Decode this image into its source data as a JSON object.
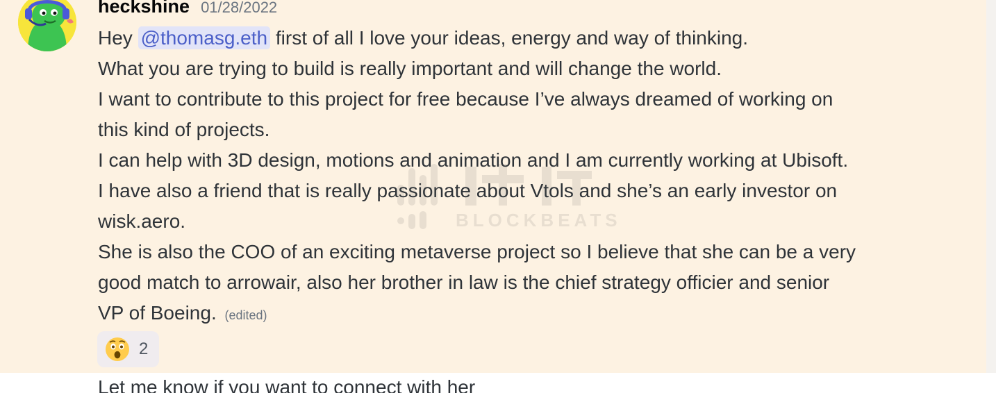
{
  "message": {
    "username": "heckshine",
    "timestamp": "01/28/2022",
    "mention": "@thomasg.eth",
    "lines": [
      "first of all I love your ideas, energy and way of thinking.",
      "What you are trying to build is really important and will change the world.",
      "I want to contribute to this project for free because I’ve always dreamed of working on",
      "this kind of  projects.",
      "I can help with 3D design, motions and animation and I am currently working at Ubisoft.",
      "I have also a friend that is really passionate about Vtols and she’s an early investor on",
      "wisk.aero.",
      "She is also the COO of an exciting metaverse project so I believe that she can be a very",
      "good match to arrowair, also her brother in law is the chief strategy officier and senior",
      "VP of Boeing."
    ],
    "greeting": "Hey",
    "edited_label": "(edited)",
    "reaction": {
      "emoji_icon": "astonished-face-icon",
      "count": "2"
    }
  },
  "next_message": {
    "text": "Let me know if you want to connect with her"
  },
  "watermark": {
    "text": "BLOCKBEATS"
  },
  "colors": {
    "highlight_bg": "#fdf2e2",
    "mention_bg": "#e2e4f8",
    "mention_text": "#4b5fc8",
    "reaction_bg": "#f0ecef"
  }
}
